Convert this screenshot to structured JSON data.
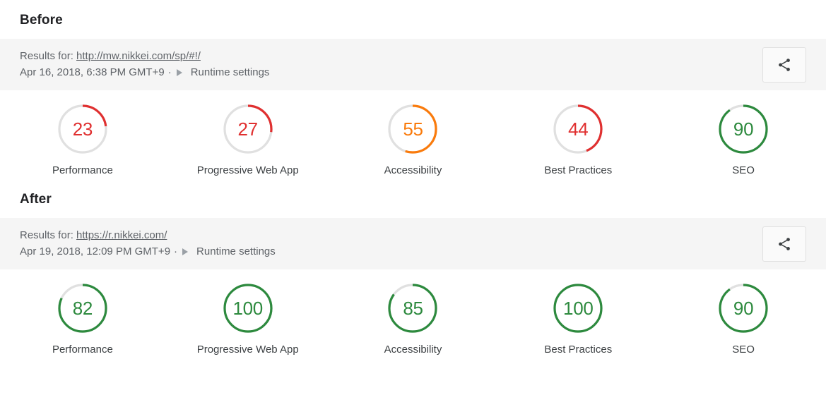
{
  "sections": [
    {
      "title": "Before",
      "header": {
        "results_prefix": "Results for:",
        "url": "http://mw.nikkei.com/sp/#!/",
        "timestamp": "Apr 16, 2018, 6:38 PM GMT+9",
        "separator": "·",
        "runtime_settings_label": "Runtime settings",
        "expand_icon": "triangle-right-icon",
        "share_icon": "share-icon",
        "background": "#f5f5f5"
      },
      "scores": [
        {
          "label": "Performance",
          "value": 23,
          "color": "#e03030"
        },
        {
          "label": "Progressive Web App",
          "value": 27,
          "color": "#e03030"
        },
        {
          "label": "Accessibility",
          "value": 55,
          "color": "#fa7b0c"
        },
        {
          "label": "Best Practices",
          "value": 44,
          "color": "#e03030"
        },
        {
          "label": "SEO",
          "value": 90,
          "color": "#2d8a3e"
        }
      ]
    },
    {
      "title": "After",
      "header": {
        "results_prefix": "Results for:",
        "url": "https://r.nikkei.com/",
        "timestamp": "Apr 19, 2018, 12:09 PM GMT+9",
        "separator": "·",
        "runtime_settings_label": "Runtime settings",
        "expand_icon": "triangle-right-icon",
        "share_icon": "share-icon",
        "background": "#f5f5f5"
      },
      "scores": [
        {
          "label": "Performance",
          "value": 82,
          "color": "#2d8a3e"
        },
        {
          "label": "Progressive Web App",
          "value": 100,
          "color": "#2d8a3e"
        },
        {
          "label": "Accessibility",
          "value": 85,
          "color": "#2d8a3e"
        },
        {
          "label": "Best Practices",
          "value": 100,
          "color": "#2d8a3e"
        },
        {
          "label": "SEO",
          "value": 90,
          "color": "#2d8a3e"
        }
      ]
    }
  ],
  "theme": {
    "track_color": "#e0e0e0",
    "red": "#e03030",
    "orange": "#fa7b0c",
    "green": "#2d8a3e",
    "text_muted": "#5f6368",
    "text_dark": "#202124"
  }
}
